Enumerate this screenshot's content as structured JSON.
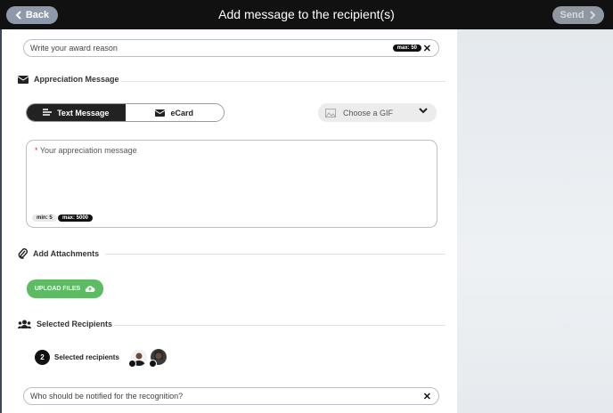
{
  "header": {
    "back_label": "Back",
    "title": "Add message to the recipient(s)",
    "send_label": "Send"
  },
  "award_reason": {
    "placeholder": "Write your award reason",
    "max_badge": "max: 50"
  },
  "appreciation": {
    "heading": "Appreciation Message",
    "tabs": [
      {
        "label": "Text Message",
        "active": true
      },
      {
        "label": "eCard",
        "active": false
      }
    ],
    "gif_label": "Choose a GIF",
    "message_required_marker": "*",
    "message_placeholder": "Your appreciation message",
    "min_badge": "min: 5",
    "max_badge": "max: 5000"
  },
  "attachments": {
    "heading": "Add Attachments",
    "upload_label": "UPLOAD FILES"
  },
  "recipients": {
    "heading": "Selected Recipients",
    "count": "2",
    "label": "Selected recipients"
  },
  "notify": {
    "placeholder": "Who should be notified for the recognition?"
  },
  "colors": {
    "accent_green": "#5dbb63",
    "header_bg": "#111111",
    "active_tab": "#222222"
  }
}
